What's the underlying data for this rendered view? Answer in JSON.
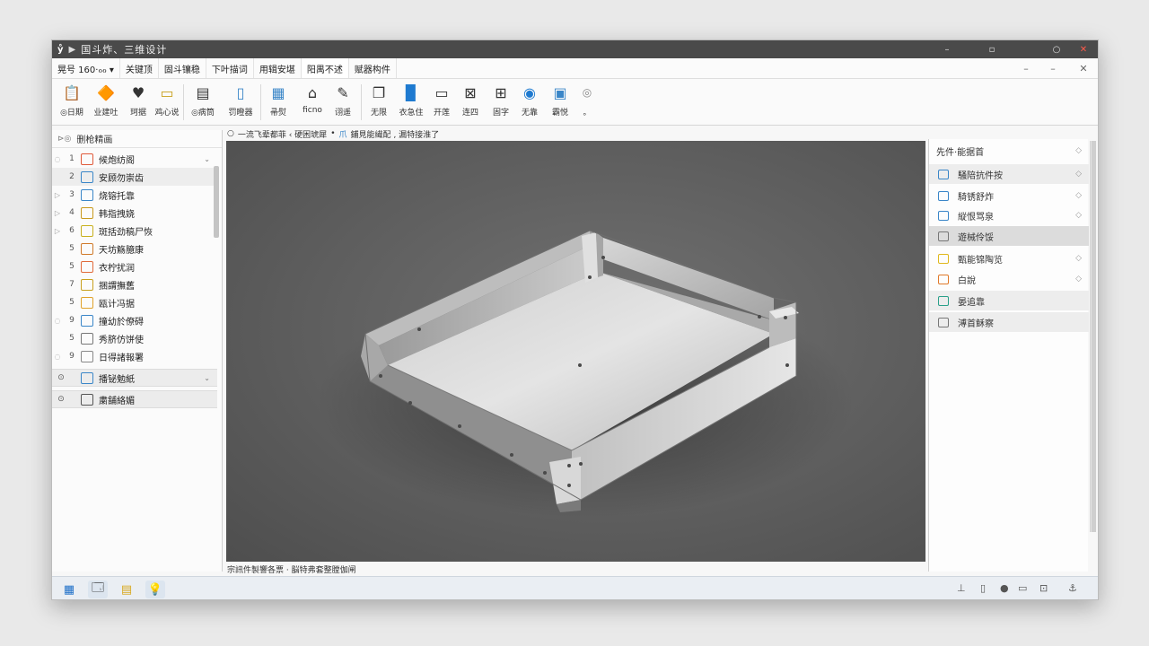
{
  "window": {
    "app_logo": "ẙ",
    "title": "国斗炸、三维设计",
    "controls": [
      "–",
      "▫",
      "○",
      "✕"
    ]
  },
  "menubar": {
    "items": [
      "晃号 160·ℴℴ ▾",
      "关键顶",
      "固斗镶稳",
      "下叶描词",
      "用辑安堪",
      "阳禺不述",
      "赋器构件"
    ],
    "window_controls": [
      "–",
      "–",
      "✕"
    ]
  },
  "ribbon": {
    "tools": [
      {
        "icon": "📋",
        "label": "◎日期"
      },
      {
        "icon": "🔶",
        "label": "业建吐"
      },
      {
        "icon": "♥",
        "label": "珂据"
      },
      {
        "icon": "▭",
        "label": "鸡心说"
      },
      {
        "icon": "▤",
        "label": "◎病筒"
      },
      {
        "icon": "▯",
        "label": "罚瞪器"
      },
      {
        "icon": "▦",
        "label": "帚熨"
      },
      {
        "icon": "⌂",
        "label": "ficno"
      },
      {
        "icon": "✎",
        "label": "诩遥"
      },
      {
        "icon": "❐",
        "label": "无限"
      },
      {
        "icon": "▉",
        "label": "衣急住"
      },
      {
        "icon": "▭",
        "label": "开莲"
      },
      {
        "icon": "⊠",
        "label": "连四"
      },
      {
        "icon": "⊞",
        "label": "固字"
      },
      {
        "icon": "◉",
        "label": "无靠"
      },
      {
        "icon": "▣",
        "label": "霸悦"
      },
      {
        "icon": "◎",
        "label": "。"
      }
    ]
  },
  "leftpanel": {
    "title": "删枪精画",
    "items": [
      {
        "num": "1",
        "label": "候炮纺阁",
        "color": "#e05a3a"
      },
      {
        "num": "2",
        "label": "安顾勿崇齿",
        "color": "#3a86c8"
      },
      {
        "num": "3",
        "label": "烧镕托靠",
        "color": "#3a86c8"
      },
      {
        "num": "4",
        "label": "韩指拽娆",
        "color": "#c89a1e"
      },
      {
        "num": "6",
        "label": "斑括劲稿尸恢",
        "color": "#c8b01e"
      },
      {
        "num": "5",
        "label": "天坊觞臆康",
        "color": "#d07a2a"
      },
      {
        "num": "5",
        "label": "衣柠扰润",
        "color": "#e06a3a"
      },
      {
        "num": "7",
        "label": "捆謂撫舊",
        "color": "#c8a01e"
      },
      {
        "num": "5",
        "label": "瓯计冯据",
        "color": "#e0a22a"
      },
      {
        "num": "9",
        "label": "撞幼於僚碍",
        "color": "#3a86c8"
      },
      {
        "num": "5",
        "label": "秀脐仿饼使",
        "color": "#777777"
      },
      {
        "num": "9",
        "label": "日得諸報署",
        "color": "#888888"
      }
    ],
    "groups": [
      {
        "label": "播铋勉紙",
        "color": "#3a86c8"
      },
      {
        "label": "粛舗絡媚",
        "color": "#555555"
      }
    ]
  },
  "breadcrumb": {
    "parts": [
      "○",
      "一流飞辈都菲 ‹ 硬困琥犀",
      "•",
      "爪",
      "鋪見能繊配 ‚ 漏特接淮了"
    ]
  },
  "status_text": "宗訊件製響各票 · 脳特弗套整膛伽闸",
  "rightpanel": {
    "title": "先件·能据首",
    "items": [
      {
        "label": "騒陪抗件按",
        "color": "#3a86c8",
        "style": "soft"
      },
      {
        "label": "騎锈舒炸",
        "color": "#3a86c8",
        "style": ""
      },
      {
        "label": "縦恨骂泉",
        "color": "#3a86c8",
        "style": ""
      },
      {
        "label": "遊械伶馁",
        "color": "#777777",
        "style": "hl"
      },
      {
        "label": "甄能锦陶览",
        "color": "#e0b81e",
        "style": ""
      },
      {
        "label": "白說",
        "color": "#e07a2a",
        "style": ""
      },
      {
        "label": "晏追靠",
        "color": "#2aa08a",
        "style": "soft"
      },
      {
        "label": "溥首稣察",
        "color": "#777777",
        "style": "soft"
      }
    ]
  },
  "taskbar": {
    "apps": [
      "▦",
      "🗔",
      "▤",
      "💡"
    ],
    "tray": [
      "⊥",
      "▯",
      "●",
      "▭",
      "⊡",
      "⚓"
    ]
  }
}
